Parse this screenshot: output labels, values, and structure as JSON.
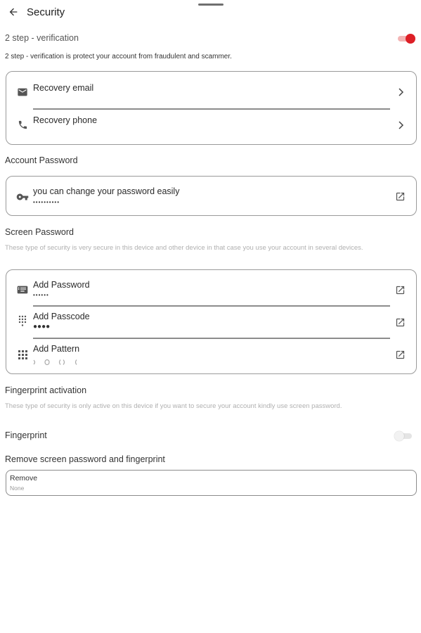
{
  "header": {
    "title": "Security"
  },
  "two_step": {
    "label": "2 step - verification",
    "enabled": true,
    "description": "2 step - verification is protect your account from fraudulent and scammer."
  },
  "recovery": {
    "items": [
      {
        "label": "Recovery email",
        "value": "",
        "icon": "email-icon",
        "action_icon": "chevron-right-icon"
      },
      {
        "label": "Recovery phone",
        "value": "",
        "icon": "phone-icon",
        "action_icon": "chevron-right-icon"
      }
    ]
  },
  "account_password": {
    "title": "Account Password",
    "label": "you can change your password easily",
    "value": "••••••••••",
    "icon": "key-icon",
    "action_icon": "open-in-new-icon"
  },
  "screen_password": {
    "title": "Screen Password",
    "description": "These type of security is very secure in this device and other device in that case you use your account in several devices.",
    "items": [
      {
        "label": "Add Password",
        "value": "••••••",
        "icon": "keyboard-icon",
        "action_icon": "open-in-new-icon"
      },
      {
        "label": "Add Passcode",
        "value": "●●●●",
        "icon": "dialpad-icon",
        "action_icon": "open-in-new-icon"
      },
      {
        "label": "Add Pattern",
        "value": "",
        "icon": "apps-grid-icon",
        "action_icon": "open-in-new-icon"
      }
    ]
  },
  "fingerprint": {
    "title": "Fingerprint activation",
    "description": "These type of security is only active on this device if you want to secure your account kindly use screen password.",
    "label": "Fingerprint",
    "enabled": false
  },
  "remove": {
    "title": "Remove screen password and fingerprint",
    "label": "Remove",
    "value": "None"
  },
  "colors": {
    "accent": "#dd1f26",
    "accent_track": "#f3b5b5",
    "border": "#9a9a9a",
    "muted_text": "#b0b0b0"
  }
}
